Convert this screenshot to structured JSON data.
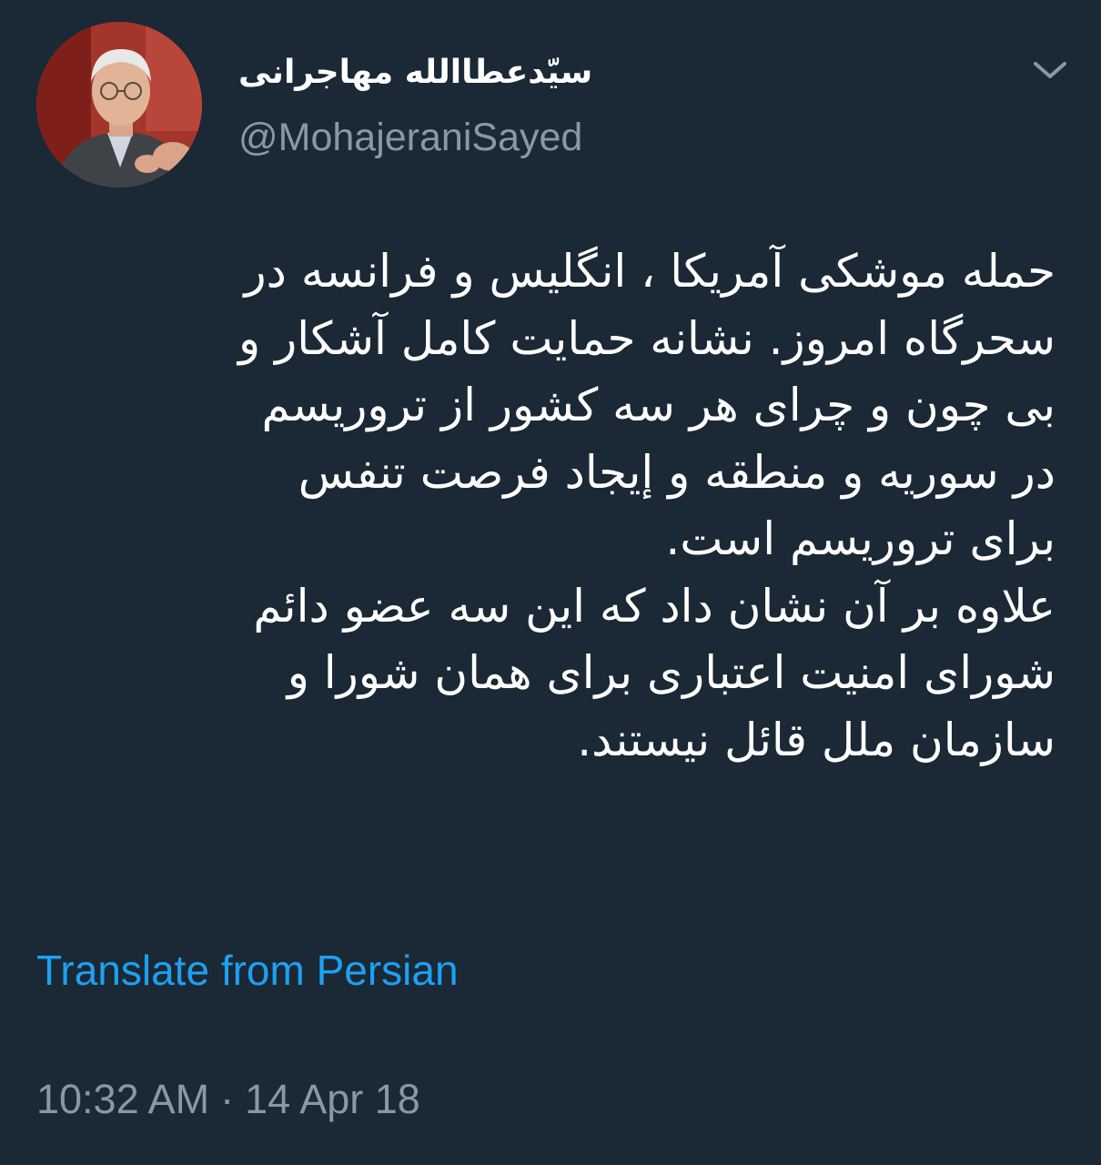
{
  "colors": {
    "background": "#1b2835",
    "text_primary": "#ffffff",
    "text_secondary": "#8899a6",
    "link": "#1da1f2"
  },
  "author": {
    "display_name": "سیّدعطاالله مهاجرانی",
    "handle": "@MohajeraniSayed",
    "avatar_icon": "profile-photo"
  },
  "header": {
    "menu_icon": "chevron-down-icon"
  },
  "tweet": {
    "lines": [
      "حمله موشکی  آمریکا ، انگلیس و فرانسه در",
      "سحرگاه امروز. نشانه حمایت کامل آشکار و",
      "بی چون و چرای هر سه کشور از تروریسم",
      "در سوریه و منطقه  و إیجاد فرصت تنفس",
      "برای تروریسم است.",
      "علاوه بر آن نشان داد که این سه عضو دائم",
      "شورای امنیت اعتباری برای همان شورا و",
      "سازمان ملل قائل نیستند."
    ],
    "translate_label": "Translate from Persian",
    "time": "10:32 AM",
    "separator": "·",
    "date": "14 Apr 18"
  }
}
